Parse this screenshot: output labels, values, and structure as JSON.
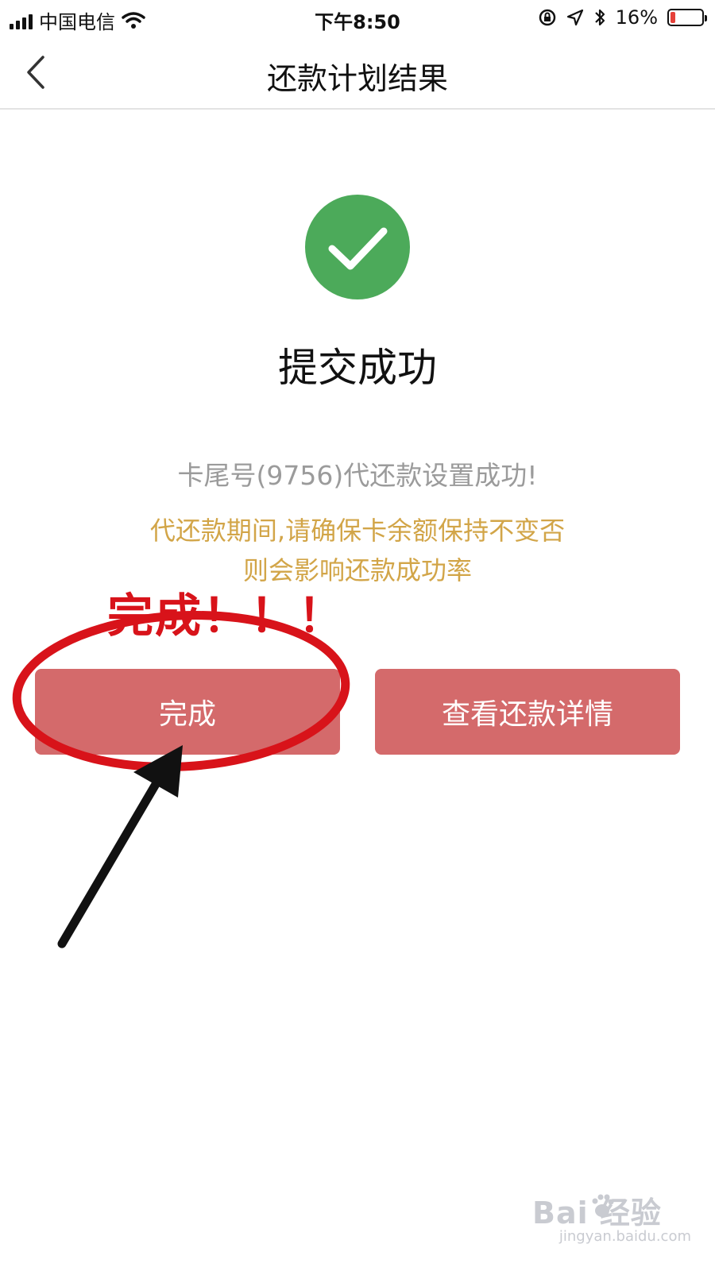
{
  "status_bar": {
    "carrier": "中国电信",
    "time": "下午8:50",
    "battery": "16%",
    "icons": [
      "signal-icon",
      "wifi-icon",
      "orientation-lock-icon",
      "location-icon",
      "bluetooth-icon",
      "battery-icon"
    ],
    "battery_color": "#e5413a"
  },
  "nav": {
    "title": "还款计划结果",
    "back_icon": "chevron-left-icon"
  },
  "result": {
    "icon": "check-circle-icon",
    "icon_color": "#4caa5a",
    "title": "提交成功",
    "card_message": "卡尾号(9756)代还款设置成功!",
    "warning_line1": "代还款期间,请确保卡余额保持不变否",
    "warning_line2": "则会影响还款成功率",
    "warning_color": "#d2a548"
  },
  "annotation": {
    "text": "完成！！！",
    "color": "#d8131a"
  },
  "buttons": {
    "done_label": "完成",
    "detail_label": "查看还款详情",
    "color": "#d46a6b"
  },
  "watermark": {
    "brand": "Bai  经验",
    "site": "jingyan.baidu.com"
  }
}
